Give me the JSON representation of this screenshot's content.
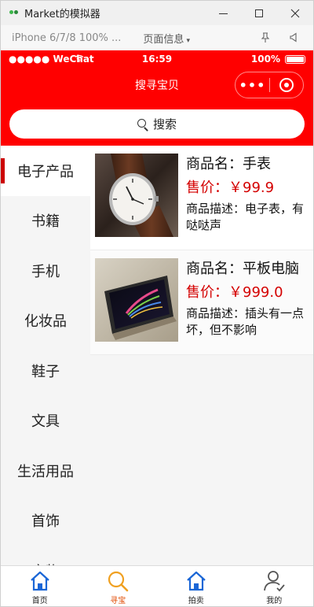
{
  "window": {
    "title": "Market的模拟器"
  },
  "simulator": {
    "device": "iPhone 6/7/8 100% ...",
    "page_info": "页面信息",
    "page_info_caret": "▾"
  },
  "statusbar": {
    "signal": "●●●●● WeChat",
    "time": "16:59",
    "battery": "100%"
  },
  "navbar": {
    "title": "搜寻宝贝",
    "menu_dots": "•••"
  },
  "search": {
    "placeholder": "搜索"
  },
  "categories": [
    {
      "label": "电子产品",
      "active": true
    },
    {
      "label": "书籍"
    },
    {
      "label": "手机"
    },
    {
      "label": "化妆品"
    },
    {
      "label": "鞋子"
    },
    {
      "label": "文具"
    },
    {
      "label": "生活用品"
    },
    {
      "label": "首饰"
    },
    {
      "label": "文物"
    }
  ],
  "products": [
    {
      "name": "商品名：手表",
      "price": "售价：￥99.9",
      "desc": "商品描述：电子表，有哒哒声",
      "image": "wristwatch"
    },
    {
      "name": "商品名：平板电脑",
      "price": "售价：￥999.0",
      "desc": "商品描述：插头有一点坏，但不影响",
      "image": "tablet"
    }
  ],
  "tabbar": {
    "items": [
      {
        "label": "首页",
        "icon": "home-icon"
      },
      {
        "label": "寻宝",
        "icon": "search-icon",
        "active": true
      },
      {
        "label": "拍卖",
        "icon": "home-icon"
      },
      {
        "label": "我的",
        "icon": "user-icon"
      }
    ],
    "active_color": "#e04a00"
  },
  "colors": {
    "brand_red": "#ff0000",
    "price_red": "#d40000",
    "home_blue": "#1a66d6"
  }
}
